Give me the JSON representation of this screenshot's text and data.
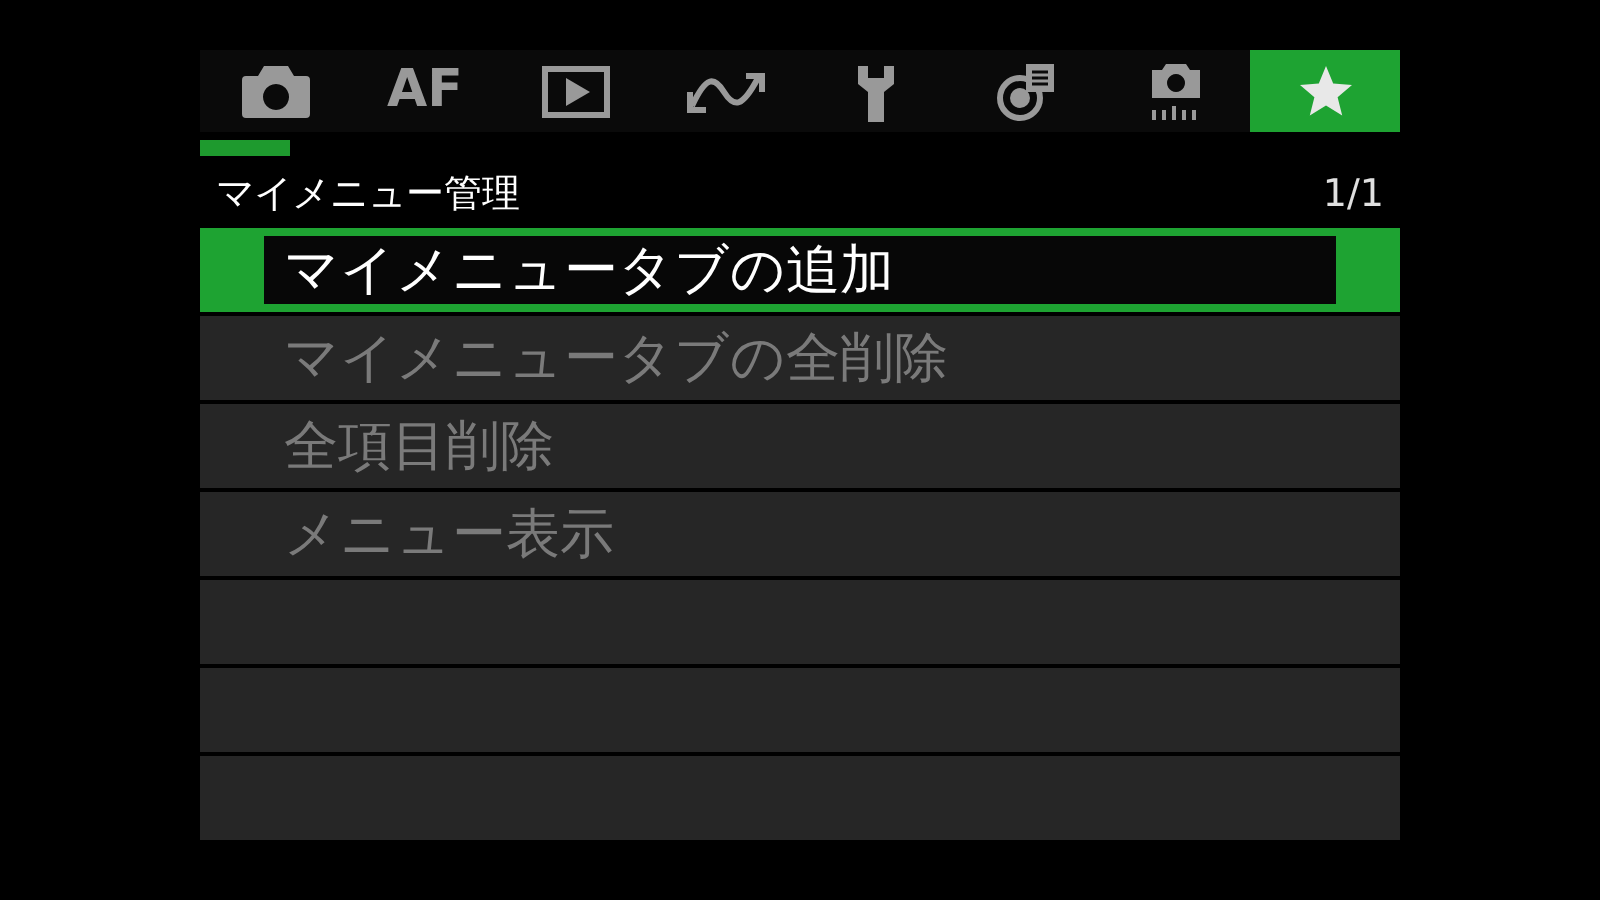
{
  "tabs": [
    {
      "kind": "camera",
      "selected": false
    },
    {
      "kind": "text",
      "label": "AF",
      "selected": false
    },
    {
      "kind": "play",
      "selected": false
    },
    {
      "kind": "wave",
      "selected": false
    },
    {
      "kind": "wrench",
      "selected": false
    },
    {
      "kind": "chart",
      "selected": false
    },
    {
      "kind": "camera-settings",
      "selected": false
    },
    {
      "kind": "star",
      "selected": true
    }
  ],
  "header": {
    "title": "マイメニュー管理",
    "page": "1/1"
  },
  "items": [
    {
      "label": "マイメニュータブの追加",
      "selected": true,
      "disabled": false
    },
    {
      "label": "マイメニュータブの全削除",
      "selected": false,
      "disabled": true
    },
    {
      "label": "全項目削除",
      "selected": false,
      "disabled": true
    },
    {
      "label": "メニュー表示",
      "selected": false,
      "disabled": true
    }
  ]
}
